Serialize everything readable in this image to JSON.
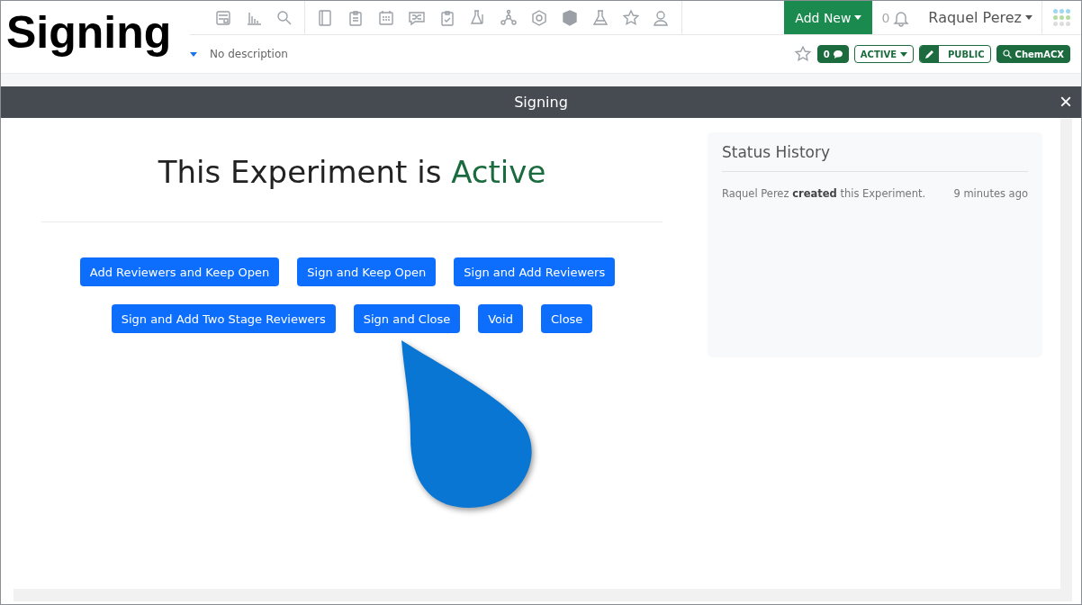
{
  "caption": "Signing",
  "navbar": {
    "add_new": "Add New",
    "notification_count": "0",
    "user": "Raquel Perez"
  },
  "header": {
    "description": "No description",
    "comment_count": "0",
    "status": "ACTIVE",
    "visibility": "PUBLIC",
    "search_label": "ChemACX"
  },
  "modal": {
    "title": "Signing",
    "close": "×",
    "heading_prefix": "This Experiment is",
    "heading_status": "Active",
    "button_rows": [
      [
        "Add Reviewers and Keep Open",
        "Sign and Keep Open",
        "Sign and Add Reviewers"
      ],
      [
        "Sign and Add Two Stage Reviewers",
        "Sign and Close",
        "Void",
        "Close"
      ]
    ],
    "status_history": {
      "title": "Status History",
      "entries": [
        {
          "text": "Raquel Perez **created** this Experiment.",
          "time": "9 minutes ago"
        }
      ]
    }
  }
}
